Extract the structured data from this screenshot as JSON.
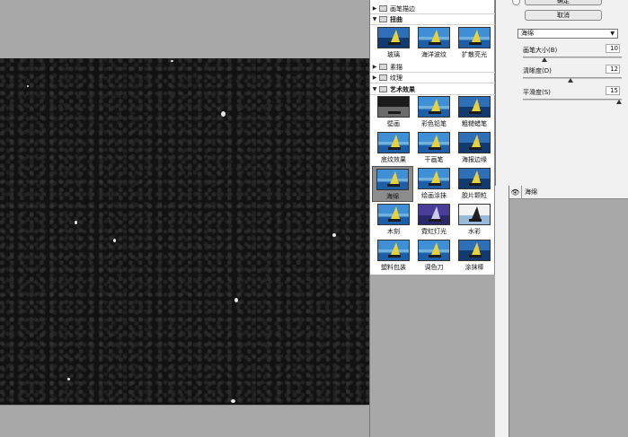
{
  "gallery": {
    "folders": [
      {
        "label": "画笔描边",
        "open": false
      },
      {
        "label": "扭曲",
        "open": true
      },
      {
        "label": "素描",
        "open": false
      },
      {
        "label": "纹理",
        "open": false
      },
      {
        "label": "艺术效果",
        "open": true
      }
    ],
    "distort_filters": [
      "玻璃",
      "海洋波纹",
      "扩散亮光"
    ],
    "artistic_filters": [
      "壁画",
      "彩色铅笔",
      "粗糙蜡笔",
      "底纹效果",
      "干画笔",
      "海报边缘",
      "海绵",
      "绘画涂抹",
      "胶片颗粒",
      "木刻",
      "霓虹灯光",
      "水彩",
      "塑料包装",
      "调色刀",
      "涂抹棒"
    ],
    "selected_filter": "海绵"
  },
  "settings": {
    "ok_label": "确定",
    "cancel_label": "取消",
    "filter_select_value": "海绵",
    "params": [
      {
        "label": "画笔大小(B)",
        "value": "10",
        "fraction": 0.2
      },
      {
        "label": "清晰度(D)",
        "value": "12",
        "fraction": 0.48
      },
      {
        "label": "平滑度(S)",
        "value": "15",
        "fraction": 1.0
      }
    ]
  },
  "layers": {
    "eye_icon": "eye-icon",
    "layer_name": "海绵"
  },
  "colors": {
    "panel_bg": "#a8a8a8",
    "preview_bg": "#121212",
    "selected_thumb": "#8c8c8c"
  }
}
